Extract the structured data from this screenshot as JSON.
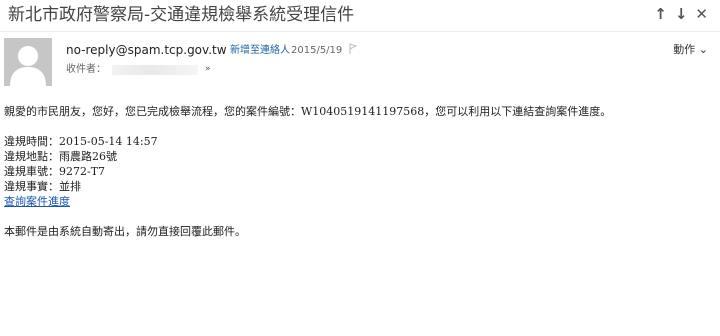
{
  "email": {
    "subject": "新北市政府警察局-交通違規檢舉系統受理信件",
    "nav": {
      "prev": "↑",
      "next": "↓",
      "close": "✕"
    },
    "sender": {
      "address": "no-reply@spam.tcp.gov.tw",
      "add_contact_label": "新增至連絡人",
      "date": "2015/5/19",
      "action_label": "動作",
      "recipient_label": "收件者："
    },
    "body": {
      "intro": "親愛的市民朋友，您好，您已完成檢舉流程，您的案件編號：W1040519141197568，您可以利用以下連結查詢案件進度。",
      "violation_time": "違規時間：2015-05-14 14:57",
      "violation_location": "違規地點：雨農路26號",
      "violation_plate": "違規車號：9272-T7",
      "violation_fact": "違規事實：並排",
      "query_link": "查詢案件進度",
      "footer": "本郵件是由系統自動寄出，請勿直接回覆此郵件。"
    }
  }
}
